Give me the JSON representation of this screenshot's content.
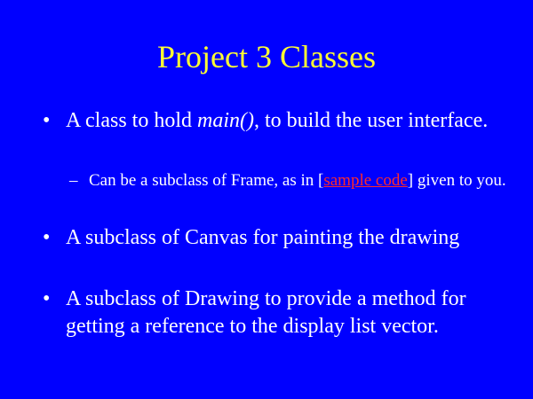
{
  "slide": {
    "title": "Project 3 Classes",
    "bullets": [
      {
        "glyph": "•",
        "before": "A class to hold ",
        "emph": "main()",
        "after": ", to build the user interface.",
        "sub": {
          "glyph": "–",
          "before": "Can be a subclass of Frame, as in [",
          "link": "sample code",
          "after": "] given to you."
        }
      },
      {
        "glyph": "•",
        "text": "A subclass of Canvas for painting the drawing"
      },
      {
        "glyph": "•",
        "text": "A subclass of Drawing to provide a method for getting a reference to the display list vector."
      }
    ]
  },
  "colors": {
    "background": "#0000ff",
    "title": "#ffff33",
    "body_text": "#ffffff",
    "link": "#ff2a2a"
  }
}
